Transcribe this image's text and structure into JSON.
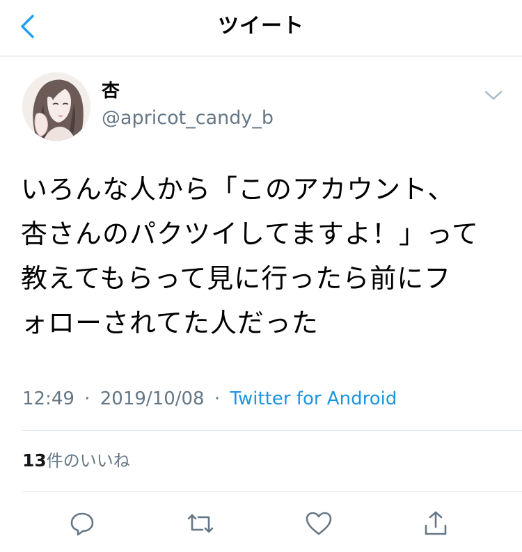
{
  "header": {
    "title": "ツイート"
  },
  "tweet": {
    "author": {
      "display_name": "杏",
      "handle": "@apricot_candy_b"
    },
    "text": "いろんな人から「このアカウント、\n杏さんのパクツイしてますよ！」って\n教えてもらって見に行ったら前にフ\nォローされてた人だった",
    "time": "12:49",
    "date": "2019/10/08",
    "separator": "·",
    "source": "Twitter for Android",
    "likes": {
      "count": "13",
      "label": "件のいいね"
    }
  },
  "colors": {
    "accent": "#1b95e0",
    "secondary_text": "#657786",
    "divider": "#e1e8ed"
  },
  "icons": {
    "back": "chevron-left-icon",
    "caret": "chevron-down-icon",
    "reply": "reply-icon",
    "retweet": "retweet-icon",
    "like": "heart-icon",
    "share": "share-icon"
  }
}
